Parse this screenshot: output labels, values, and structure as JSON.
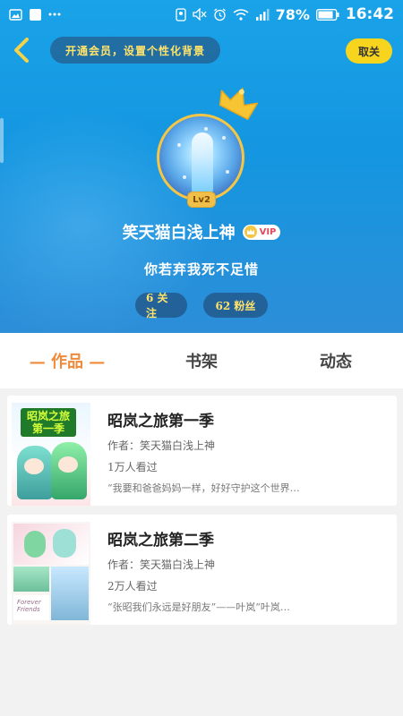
{
  "status_bar": {
    "battery": "78%",
    "time": "16:42",
    "icons": [
      "image-icon",
      "app-icon",
      "more-dots-icon",
      "location-icon",
      "mute-icon",
      "alarm-icon",
      "wifi-icon",
      "signal-icon",
      "battery-icon"
    ]
  },
  "header": {
    "vip_banner": "开通会员，设置个性化背景",
    "top_right_button": "取关",
    "level_badge": "Lv2",
    "username": "笑天猫白浅上神",
    "vip_badge": "VIP",
    "signature": "你若弃我死不足惜",
    "following": "6 关注",
    "followers": "62 粉丝",
    "gradient_color": "#1aa3e8"
  },
  "tabs": [
    {
      "label": "— 作品 —",
      "active": true
    },
    {
      "label": "书架",
      "active": false
    },
    {
      "label": "动态",
      "active": false
    }
  ],
  "works": [
    {
      "title": "昭岚之旅第一季",
      "author": "作者：笑天猫白浅上神",
      "views": "1万人看过",
      "description": "“我要和爸爸妈妈一样，好好守护这个世界…",
      "thumb_text": "昭岚之旅 第一季"
    },
    {
      "title": "昭岚之旅第二季",
      "author": "作者：笑天猫白浅上神",
      "views": "2万人看过",
      "description": "“张昭我们永远是好朋友”——叶岚“叶岚…",
      "thumb_text": "Forever Friends"
    }
  ],
  "colors": {
    "accent_orange": "#ef8a3a",
    "gold": "#f7d51e",
    "vip_text": "#ffe36a"
  }
}
